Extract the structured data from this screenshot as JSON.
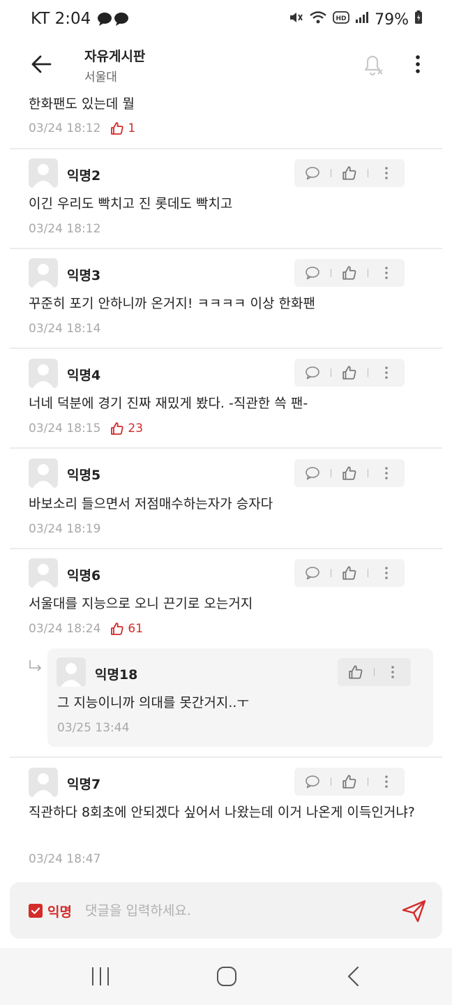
{
  "status_bar": {
    "carrier_time": "KT 2:04",
    "battery": "79%"
  },
  "header": {
    "title": "자유게시판",
    "subtitle": "서울대"
  },
  "comments": [
    {
      "author": "",
      "text": "한화팬도 있는데 뭘",
      "time": "03/24 18:12",
      "likes": "1"
    },
    {
      "author": "익명2",
      "text": "이긴 우리도 빡치고 진 롯데도 빡치고",
      "time": "03/24 18:12",
      "likes": ""
    },
    {
      "author": "익명3",
      "text": "꾸준히 포기 안하니까 온거지! ㅋㅋㅋㅋ 이상 한화팬",
      "time": "03/24 18:14",
      "likes": ""
    },
    {
      "author": "익명4",
      "text": "너네 덕분에 경기 진짜 재밌게 봤다. -직관한 쓱 팬-",
      "time": "03/24 18:15",
      "likes": "23"
    },
    {
      "author": "익명5",
      "text": "바보소리 들으면서 저점매수하는자가 승자다",
      "time": "03/24 18:19",
      "likes": ""
    },
    {
      "author": "익명6",
      "text": "서울대를 지능으로 오니 끈기로 오는거지",
      "time": "03/24 18:24",
      "likes": "61"
    },
    {
      "author": "익명18",
      "text": "그 지능이니까 의대를 못간거지..ㅜ",
      "time": "03/25 13:44",
      "likes": ""
    },
    {
      "author": "익명7",
      "text": "직관하다 8회초에 안되겠다 싶어서 나왔는데 이거 나온게 이득인거냐?",
      "time": "03/24 18:47",
      "likes": ""
    }
  ],
  "input": {
    "anon_label": "익명",
    "placeholder": "댓글을 입력하세요."
  },
  "colors": {
    "accent": "#d42b2b",
    "meta": "#a8a8a8",
    "action_bg": "#f3f3f3"
  }
}
